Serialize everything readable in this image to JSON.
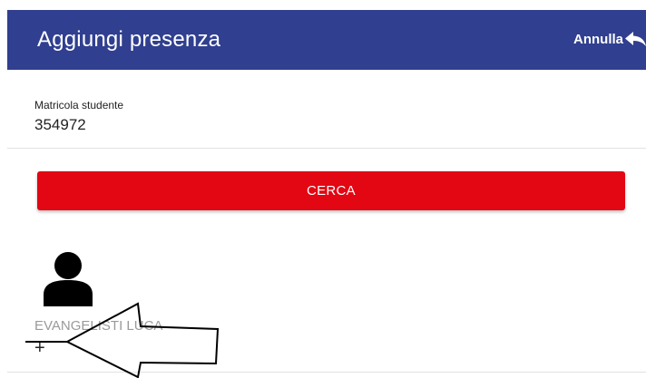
{
  "header": {
    "title": "Aggiungi presenza",
    "cancel_label": "Annulla",
    "cancel_icon": "reply-arrow-icon",
    "background_color": "#303f8f"
  },
  "form": {
    "student_id_label": "Matricola studente",
    "student_id_value": "354972"
  },
  "search_button": {
    "label": "CERCA",
    "color": "#e30613"
  },
  "result": {
    "avatar_icon": "person-icon",
    "student_name": "EVANGELISTI LUCA",
    "add_label": "+",
    "add_icon": "plus-icon"
  },
  "annotation": {
    "icon": "hand-drawn-arrow-icon"
  }
}
